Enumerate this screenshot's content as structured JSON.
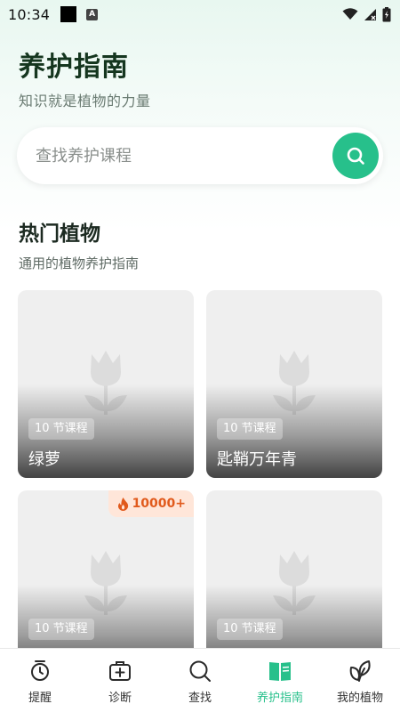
{
  "status_bar": {
    "time": "10:34"
  },
  "header": {
    "title": "养护指南",
    "subtitle": "知识就是植物的力量"
  },
  "search": {
    "placeholder": "查找养护课程",
    "value": ""
  },
  "section": {
    "title": "热门植物",
    "subtitle": "通用的植物养护指南"
  },
  "cards": [
    {
      "tag": "10 节课程",
      "name": "绿萝",
      "hot": ""
    },
    {
      "tag": "10 节课程",
      "name": "匙鞘万年青",
      "hot": ""
    },
    {
      "tag": "10 节课程",
      "name": "",
      "hot": "10000+"
    },
    {
      "tag": "10 节课程",
      "name": "",
      "hot": ""
    }
  ],
  "nav": {
    "items": [
      {
        "label": "提醒",
        "icon": "alarm-clock-icon"
      },
      {
        "label": "诊断",
        "icon": "medical-kit-icon"
      },
      {
        "label": "查找",
        "icon": "search-icon"
      },
      {
        "label": "养护指南",
        "icon": "open-book-icon"
      },
      {
        "label": "我的植物",
        "icon": "leaves-icon"
      }
    ],
    "active_index": 3
  },
  "colors": {
    "accent": "#27c08b",
    "title": "#15361f",
    "hot": "#e15a1c",
    "hot_bg": "#ffe6d9"
  }
}
